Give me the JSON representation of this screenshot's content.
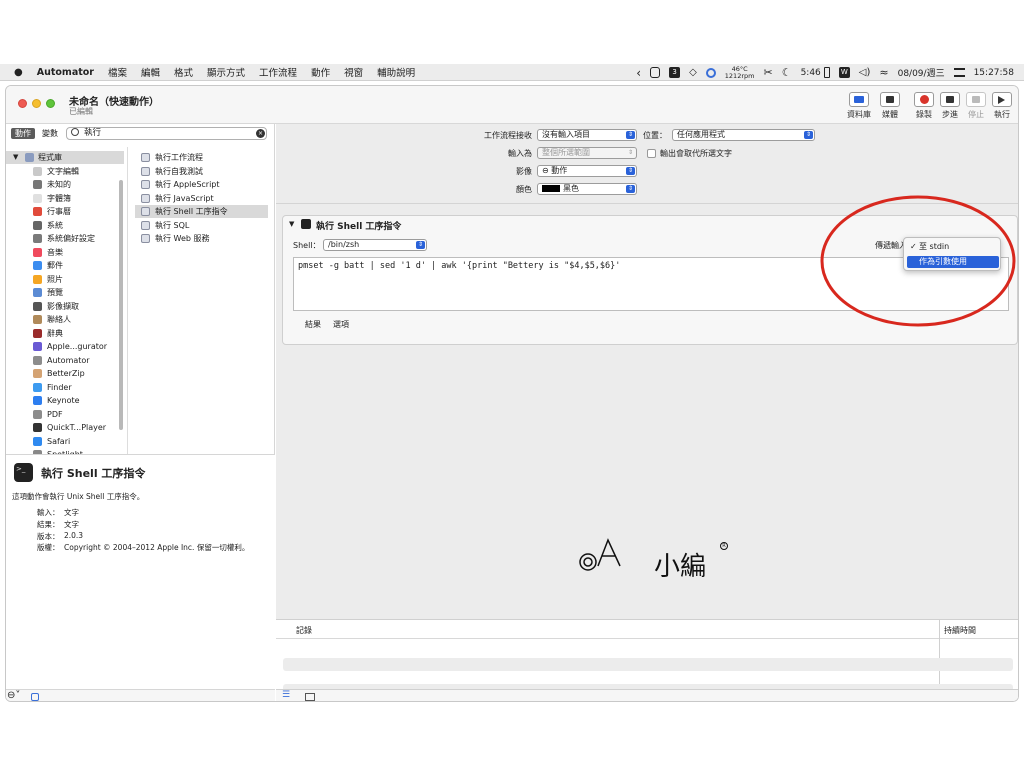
{
  "menubar": {
    "apple": "",
    "app_name": "Automator",
    "items": [
      "檔案",
      "編輯",
      "格式",
      "顯示方式",
      "工作流程",
      "動作",
      "視窗",
      "輔助說明"
    ],
    "status": {
      "back": "‹",
      "badge_number": "3",
      "temp": "46°C",
      "rpm": "1212rpm",
      "battery_time": "5:46",
      "date": "08/09/週三",
      "time": "15:27:58"
    }
  },
  "window": {
    "title": "未命名（快速動作）",
    "subtitle": "已編輯",
    "toolbar": [
      {
        "label": "資料庫",
        "color": "#2a62d9"
      },
      {
        "label": "媒體",
        "color": "#333333"
      },
      {
        "label": "錄製",
        "color": "#d9342b"
      },
      {
        "label": "步進",
        "color": "#333333"
      },
      {
        "label": "停止",
        "color": "#999999"
      },
      {
        "label": "執行",
        "color": "#333333"
      }
    ]
  },
  "left": {
    "tab_actions": "動作",
    "tab_variables": "變數",
    "search_value": "執行",
    "library": [
      {
        "label": "程式庫",
        "color": "#8a9bbf"
      },
      {
        "label": "文字編輯",
        "color": "#c9c9c9"
      },
      {
        "label": "未知的",
        "color": "#777777"
      },
      {
        "label": "字體簿",
        "color": "#e0e0e0"
      },
      {
        "label": "行事曆",
        "color": "#e14b3b"
      },
      {
        "label": "系統",
        "color": "#666666"
      },
      {
        "label": "系統偏好設定",
        "color": "#7a7a7a"
      },
      {
        "label": "音樂",
        "color": "#f04a5d"
      },
      {
        "label": "郵件",
        "color": "#3b8df0"
      },
      {
        "label": "照片",
        "color": "#f5a623"
      },
      {
        "label": "預覽",
        "color": "#5b8bd4"
      },
      {
        "label": "影像擷取",
        "color": "#555555"
      },
      {
        "label": "聯絡人",
        "color": "#b08a5a"
      },
      {
        "label": "辭典",
        "color": "#9a2b2b"
      },
      {
        "label": "Apple...gurator",
        "color": "#6a5ad4"
      },
      {
        "label": "Automator",
        "color": "#8c8c8c"
      },
      {
        "label": "BetterZip",
        "color": "#d4a373"
      },
      {
        "label": "Finder",
        "color": "#3d9bf0"
      },
      {
        "label": "Keynote",
        "color": "#2d7ef0"
      },
      {
        "label": "PDF",
        "color": "#8c8c8c"
      },
      {
        "label": "QuickT...Player",
        "color": "#333333"
      },
      {
        "label": "Safari",
        "color": "#2f8af0"
      },
      {
        "label": "Spotlight",
        "color": "#888888"
      }
    ],
    "actions": [
      "執行工作流程",
      "執行自我測試",
      "執行 AppleScript",
      "執行 JavaScript",
      "執行 Shell 工序指令",
      "執行 SQL",
      "執行 Web 服務"
    ],
    "selected_action_index": 4,
    "description": {
      "title": "執行 Shell 工序指令",
      "text": "這項動作會執行 Unix Shell 工序指令。",
      "input_key": "輸入：",
      "input_val": "文字",
      "result_key": "結果：",
      "result_val": "文字",
      "version_key": "版本：",
      "version_val": "2.0.3",
      "copyright_key": "版權：",
      "copyright_val": "Copyright © 2004–2012 Apple Inc. 保留一切權利。"
    }
  },
  "workflow": {
    "receives_label": "工作流程接收",
    "receives_value": "沒有輸入項目",
    "location_label": "位置：",
    "location_value": "任何應用程式",
    "input_label": "輸入為",
    "input_value": "整個所選範圍",
    "replace_label": "輸出會取代所選文字",
    "image_label": "影像",
    "image_value": "⊖ 動作",
    "color_label": "顏色",
    "color_value": "黑色"
  },
  "card": {
    "title": "執行 Shell 工序指令",
    "shell_label": "Shell：",
    "shell_value": "/bin/zsh",
    "pass_input_label": "傳遞輸入：",
    "code": "pmset -g batt | sed '1 d' | awk '{print \"Bettery is \"$4,$5,$6}'",
    "tab_results": "結果",
    "tab_options": "選項",
    "menu_items": [
      {
        "label": "至 stdin",
        "checked": true
      },
      {
        "label": "作為引數使用",
        "checked": false
      }
    ]
  },
  "watermark": "小編",
  "log": {
    "col_log": "記錄",
    "col_duration": "持續時間"
  }
}
